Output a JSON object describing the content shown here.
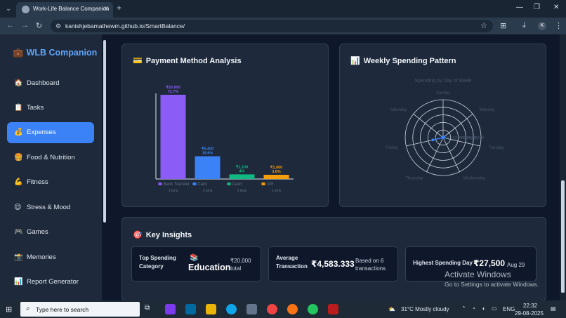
{
  "browser": {
    "tab_title": "Work-Life Balance Companion",
    "url": "kanishjebamathewm.github.io/SmartBalance/",
    "profile_initial": "K",
    "icons": [
      "tab-list-icon",
      "close-icon",
      "plus-icon",
      "minimize-icon",
      "restore-icon",
      "back-icon",
      "forward-icon",
      "reload-icon",
      "site-info-icon",
      "star-icon",
      "translate-icon",
      "download-icon",
      "menu-icon"
    ]
  },
  "sidebar": {
    "brand": "WLB Companion",
    "items": [
      {
        "label": "Dashboard",
        "icon": "house-icon"
      },
      {
        "label": "Tasks",
        "icon": "clipboard-icon"
      },
      {
        "label": "Expenses",
        "icon": "money-bag-icon"
      },
      {
        "label": "Food & Nutrition",
        "icon": "food-icon"
      },
      {
        "label": "Fitness",
        "icon": "flexed-arm-icon"
      },
      {
        "label": "Stress & Mood",
        "icon": "smiley-icon"
      },
      {
        "label": "Games",
        "icon": "gamepad-icon"
      },
      {
        "label": "Memories",
        "icon": "photo-icon"
      },
      {
        "label": "Report Generator",
        "icon": "bar-chart-icon"
      }
    ],
    "active_index": 2
  },
  "payment_card": {
    "title": "Payment Method Analysis",
    "chart_data": {
      "type": "bar",
      "categories": [
        "Bank Transfer",
        "Card",
        "Cash",
        "UPI"
      ],
      "values": [
        20000,
        5400,
        1100,
        1000
      ],
      "value_labels": [
        "₹20,000",
        "₹5,400",
        "₹1,100",
        "₹1,000"
      ],
      "percent_labels": [
        "72.7%",
        "19.6%",
        "4%",
        "3.6%"
      ],
      "counts": [
        "1 tons",
        "2 tons",
        "2 tons",
        "1 tons"
      ],
      "colors": [
        "#8b5cf6",
        "#3b82f6",
        "#10b981",
        "#f59e0b"
      ],
      "ylim": [
        0,
        22000
      ]
    }
  },
  "weekly_card": {
    "title": "Weekly Spending Pattern",
    "chart_data": {
      "type": "radar",
      "title": "Spending by Day of Week",
      "categories": [
        "Sunday",
        "Monday",
        "Tuesday",
        "Wednesday",
        "Thursday",
        "Friday",
        "Saturday"
      ],
      "values": [
        0,
        3000,
        0,
        0,
        0,
        27500,
        0
      ],
      "tick_labels": [
        "₹0",
        "₹20,000",
        "₹40,000",
        "₹60,000",
        "₹80,000"
      ],
      "color": "#3b82f6",
      "rmax": 100000
    }
  },
  "insights": {
    "title": "Key Insights",
    "top_category": {
      "label": "Top Spending Category",
      "value": "Education",
      "sub": "₹20,000 total",
      "icon": "books-icon"
    },
    "avg_transaction": {
      "label": "Average Transaction",
      "value": "₹4,583.333",
      "sub": "Based on 6 transactions"
    },
    "highest_day": {
      "label": "Highest Spending Day",
      "value": "₹27,500",
      "sub": "Aug 29"
    }
  },
  "watermark": {
    "line1": "Activate Windows",
    "line2": "Go to Settings to activate Windows."
  },
  "taskbar": {
    "search_placeholder": "Type here to search",
    "weather": "31°C  Mostly cloudy",
    "lang": "ENG",
    "time": "22:32",
    "date": "29-08-2025"
  }
}
